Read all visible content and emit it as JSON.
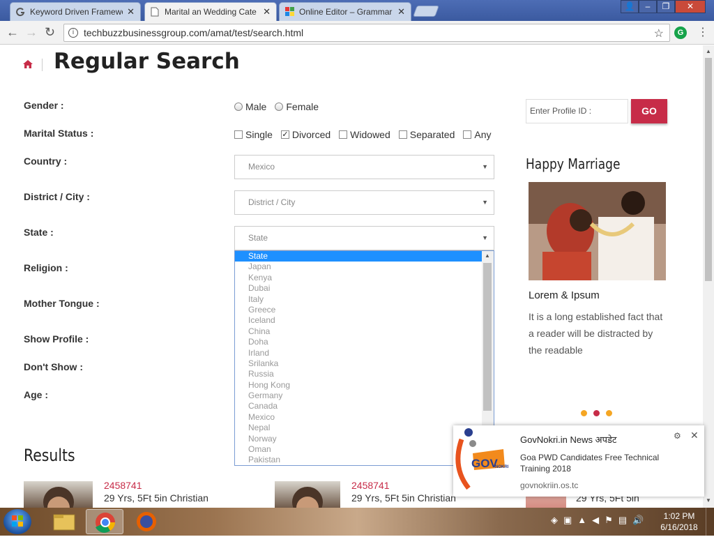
{
  "browser": {
    "tabs": [
      {
        "title": "Keyword Driven Framewo",
        "icon": "g-logo-icon"
      },
      {
        "title": "Marital an Wedding Cate",
        "icon": "document-icon"
      },
      {
        "title": "Online Editor – Grammar",
        "icon": "grid-icon"
      }
    ],
    "url": "techbuzzbusinessgroup.com/amat/test/search.html"
  },
  "page": {
    "title": "Regular Search",
    "labels": {
      "gender": "Gender :",
      "marital": "Marital Status :",
      "country": "Country :",
      "district": "District / City :",
      "state": "State :",
      "religion": "Religion :",
      "tongue": "Mother Tongue :",
      "show": "Show Profile :",
      "dontshow": "Don't Show :",
      "age": "Age :"
    },
    "gender_options": [
      "Male",
      "Female"
    ],
    "marital_options": [
      "Single",
      "Divorced",
      "Widowed",
      "Separated",
      "Any"
    ],
    "marital_checked": "Divorced",
    "country_value": "Mexico",
    "district_value": "District / City",
    "state_value": "State",
    "state_options": [
      "State",
      "Japan",
      "Kenya",
      "Dubai",
      "Italy",
      "Greece",
      "Iceland",
      "China",
      "Doha",
      "Irland",
      "Srilanka",
      "Russia",
      "Hong Kong",
      "Germany",
      "Canada",
      "Mexico",
      "Nepal",
      "Norway",
      "Oman",
      "Pakistan"
    ],
    "profile_id_placeholder": "Enter Profile ID :",
    "go_label": "GO",
    "side": {
      "title": "Happy Marriage",
      "subtitle": "Lorem & Ipsum",
      "text": "It is a long established fact that a reader will be distracted by the readable"
    },
    "results_title": "Results",
    "results": [
      {
        "id": "2458741",
        "info": "29 Yrs, 5Ft 5in Christian"
      },
      {
        "id": "2458741",
        "info": "29 Yrs, 5Ft 5in Christian"
      },
      {
        "id": "",
        "info": "29 Yrs, 5Ft 5in"
      }
    ]
  },
  "notification": {
    "title": "GovNokri.in News अपडेट",
    "body": "Goa PWD Candidates Free Technical Training 2018",
    "source": "govnokriin.os.tc",
    "logo_text": "GOV",
    "logo_sub": "NOKRI"
  },
  "taskbar": {
    "time": "1:02 PM",
    "date": "6/16/2018"
  },
  "colors": {
    "accent": "#c72c48",
    "select_highlight": "#1e90ff",
    "dot": "#f5a623"
  }
}
